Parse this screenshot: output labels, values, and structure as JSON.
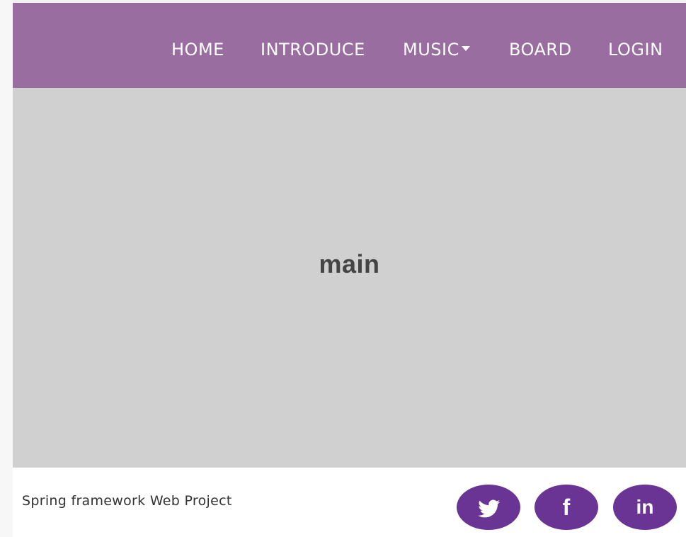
{
  "nav": {
    "items": [
      {
        "label": "HOME"
      },
      {
        "label": "INTRODUCE"
      },
      {
        "label": "MUSIC",
        "has_dropdown": true
      },
      {
        "label": "BOARD"
      },
      {
        "label": "LOGIN"
      }
    ]
  },
  "main": {
    "title": "main"
  },
  "footer": {
    "text": "Spring framework Web Project",
    "social": [
      {
        "icon": "twitter-icon"
      },
      {
        "icon": "facebook-icon",
        "glyph": "f"
      },
      {
        "icon": "linkedin-icon",
        "glyph": "in"
      }
    ]
  },
  "colors": {
    "navbar_bg": "#9a6da0",
    "main_bg": "#d0d0d0",
    "social_bg": "#6a3494",
    "nav_text": "#ffffff",
    "title_text": "#444444"
  }
}
